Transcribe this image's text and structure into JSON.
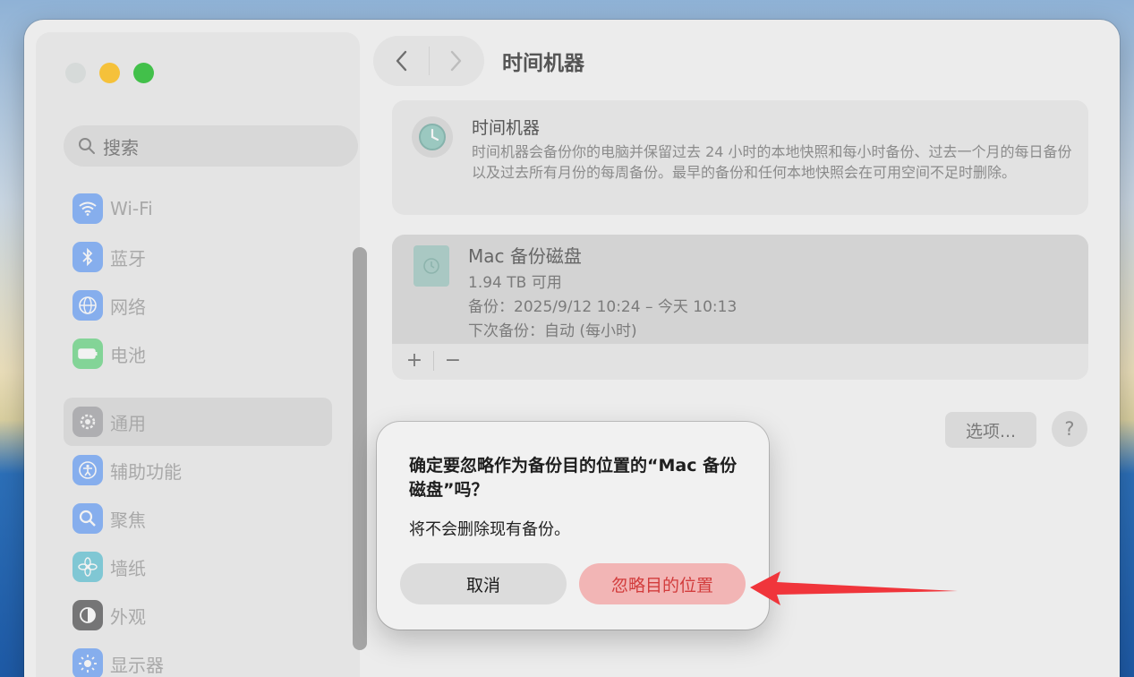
{
  "window": {
    "title": "时间机器"
  },
  "sidebar": {
    "search_placeholder": "搜索",
    "items": [
      {
        "label": "Wi-Fi",
        "icon": "wifi-icon",
        "color": "#3b82f6"
      },
      {
        "label": "蓝牙",
        "icon": "bluetooth-icon",
        "color": "#3b82f6"
      },
      {
        "label": "网络",
        "icon": "globe-icon",
        "color": "#3b82f6"
      },
      {
        "label": "电池",
        "icon": "battery-icon",
        "color": "#34c759"
      },
      {
        "label": "通用",
        "icon": "gear-icon",
        "color": "#8e8e93",
        "selected": true
      },
      {
        "label": "辅助功能",
        "icon": "accessibility-icon",
        "color": "#3b82f6"
      },
      {
        "label": "聚焦",
        "icon": "magnifier-icon",
        "color": "#3b82f6"
      },
      {
        "label": "墙纸",
        "icon": "flower-icon",
        "color": "#30b0c7"
      },
      {
        "label": "外观",
        "icon": "appearance-icon",
        "color": "#1c1c1e"
      },
      {
        "label": "显示器",
        "icon": "sun-icon",
        "color": "#3b82f6"
      }
    ]
  },
  "main": {
    "info_card": {
      "title": "时间机器",
      "description": "时间机器会备份你的电脑并保留过去 24 小时的本地快照和每小时备份、过去一个月的每日备份以及过去所有月份的每周备份。最早的备份和任何本地快照会在可用空间不足时删除。"
    },
    "disk_card": {
      "name": "Mac 备份磁盘",
      "available": "1.94 TB 可用",
      "backups": "备份：2025/9/12 10:24 – 今天 10:13",
      "next_backup": "下次备份：自动 (每小时)",
      "add_label": "+",
      "remove_label": "−"
    },
    "options_label": "选项...",
    "help_label": "?"
  },
  "dialog": {
    "title": "确定要忽略作为备份目的位置的“Mac 备份磁盘”吗？",
    "message": "将不会删除现有备份。",
    "cancel_label": "取消",
    "confirm_label": "忽略目的位置"
  },
  "colors": {
    "annotation_arrow": "#f0353b",
    "destructive_text": "#d23c3c"
  }
}
